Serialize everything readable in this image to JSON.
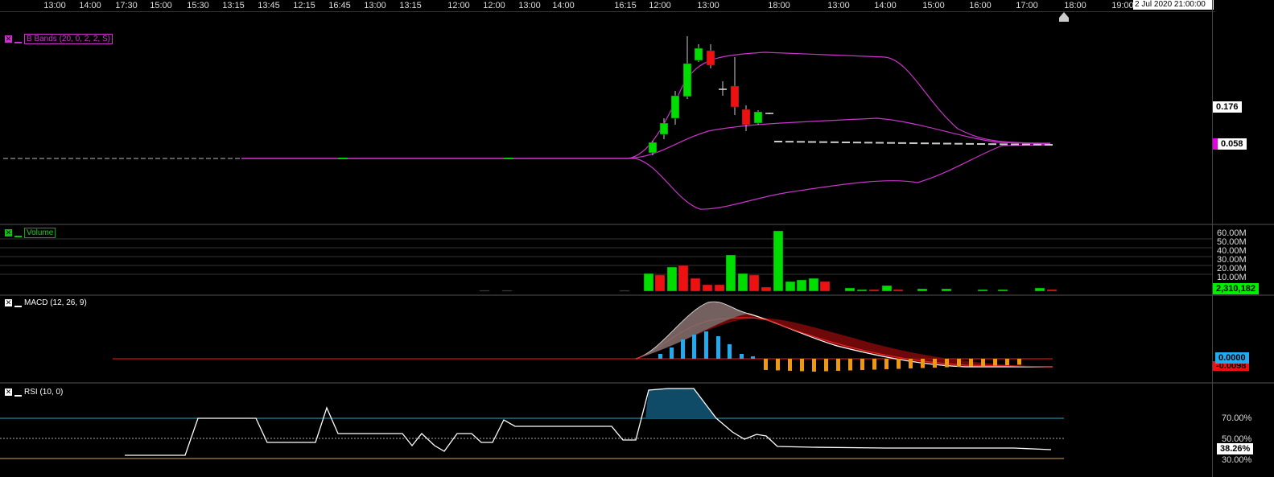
{
  "time_axis": {
    "labels": [
      "13:00",
      "14:00",
      "17:30",
      "15:00",
      "15:30",
      "13:15",
      "13:45",
      "12:15",
      "16:45",
      "13:00",
      "13:15",
      "12:00",
      "12:00",
      "13:00",
      "14:00",
      "16:15",
      "12:00",
      "13:00",
      "18:00",
      "13:00",
      "14:00",
      "15:00",
      "16:00",
      "17:00",
      "18:00",
      "19:00"
    ],
    "date_label": "2 Jul 2020 21:00:00"
  },
  "bbands": {
    "legend": "B Bands (20, 0, 2, 2, S)",
    "price_label": "0.176",
    "last_label": "0.058",
    "colors": {
      "band": "#cc33cc",
      "up": "#00dd00",
      "down": "#ee1111"
    }
  },
  "volume": {
    "legend": "Volume",
    "axis_labels": [
      "60.00M",
      "50.00M",
      "40.00M",
      "30.00M",
      "20.00M",
      "10.00M"
    ],
    "last_label": "2,310,182"
  },
  "macd": {
    "legend": "MACD (12, 26, 9)",
    "value_label": "0.0000",
    "signal_label": "-0.0098"
  },
  "rsi": {
    "legend": "RSI (10, 0)",
    "axis_labels": [
      "70.00%",
      "50.00%",
      "30.00%"
    ],
    "value_label": "38.26%"
  }
}
